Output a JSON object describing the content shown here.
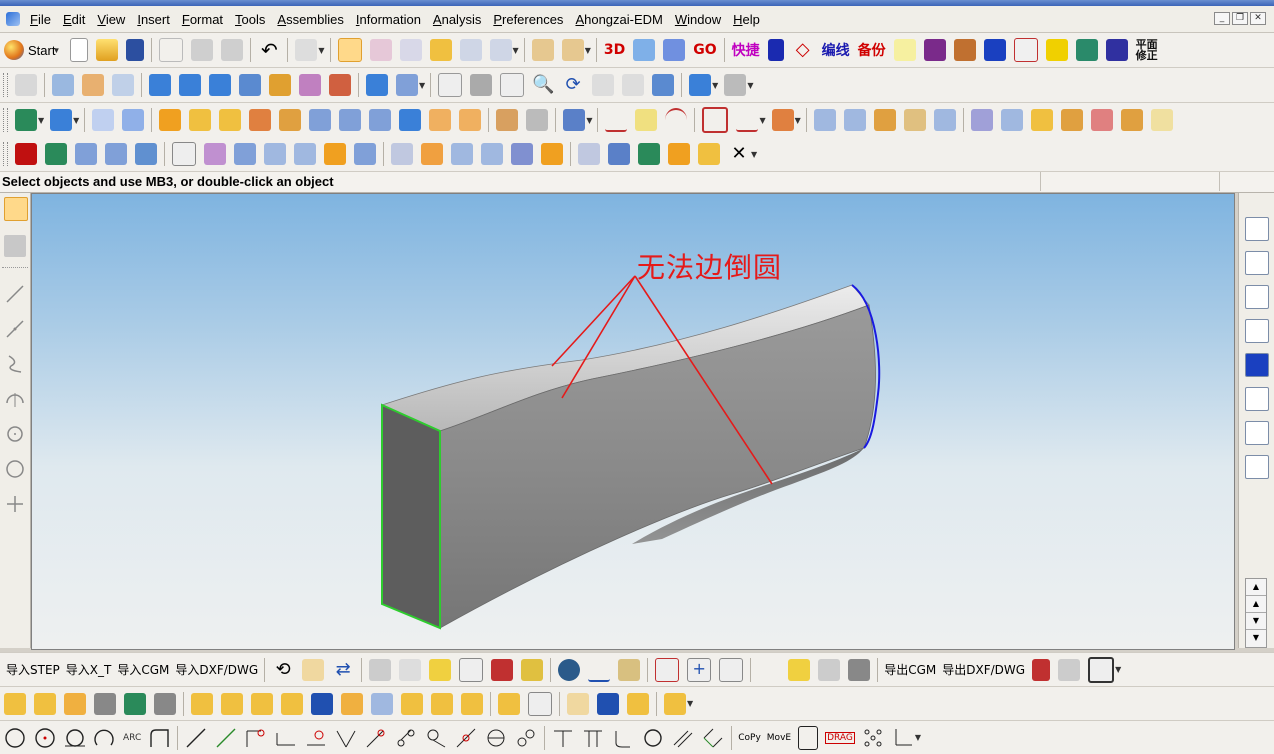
{
  "menu": {
    "items": [
      "File",
      "Edit",
      "View",
      "Insert",
      "Format",
      "Tools",
      "Assemblies",
      "Information",
      "Analysis",
      "Preferences",
      "Ahongzai-EDM",
      "Window",
      "Help"
    ]
  },
  "toolbar1": {
    "start_label": "Start",
    "custom_labels": [
      "3D",
      "GO",
      "快捷",
      "编线",
      "备份",
      "平面修正"
    ]
  },
  "status": {
    "prompt": "Select objects and use MB3, or double-click an object"
  },
  "viewport": {
    "annotation": "无法边倒圆",
    "annotation_color": "#e51a1a",
    "edge_highlight_front": "#2ecc2e",
    "edge_highlight_back": "#1a1ae0"
  },
  "bottombar1": {
    "import_step": "导入STEP",
    "import_xt": "导入X_T",
    "import_cgm": "导入CGM",
    "import_dxf": "导入DXF/DWG",
    "export_cgm": "导出CGM",
    "export_dxf": "导出DXF/DWG"
  },
  "bottombar3": {
    "arc_label": "ARC",
    "copy_label": "CoPy",
    "move_label": "MovE",
    "drag_label": "DRAG"
  }
}
